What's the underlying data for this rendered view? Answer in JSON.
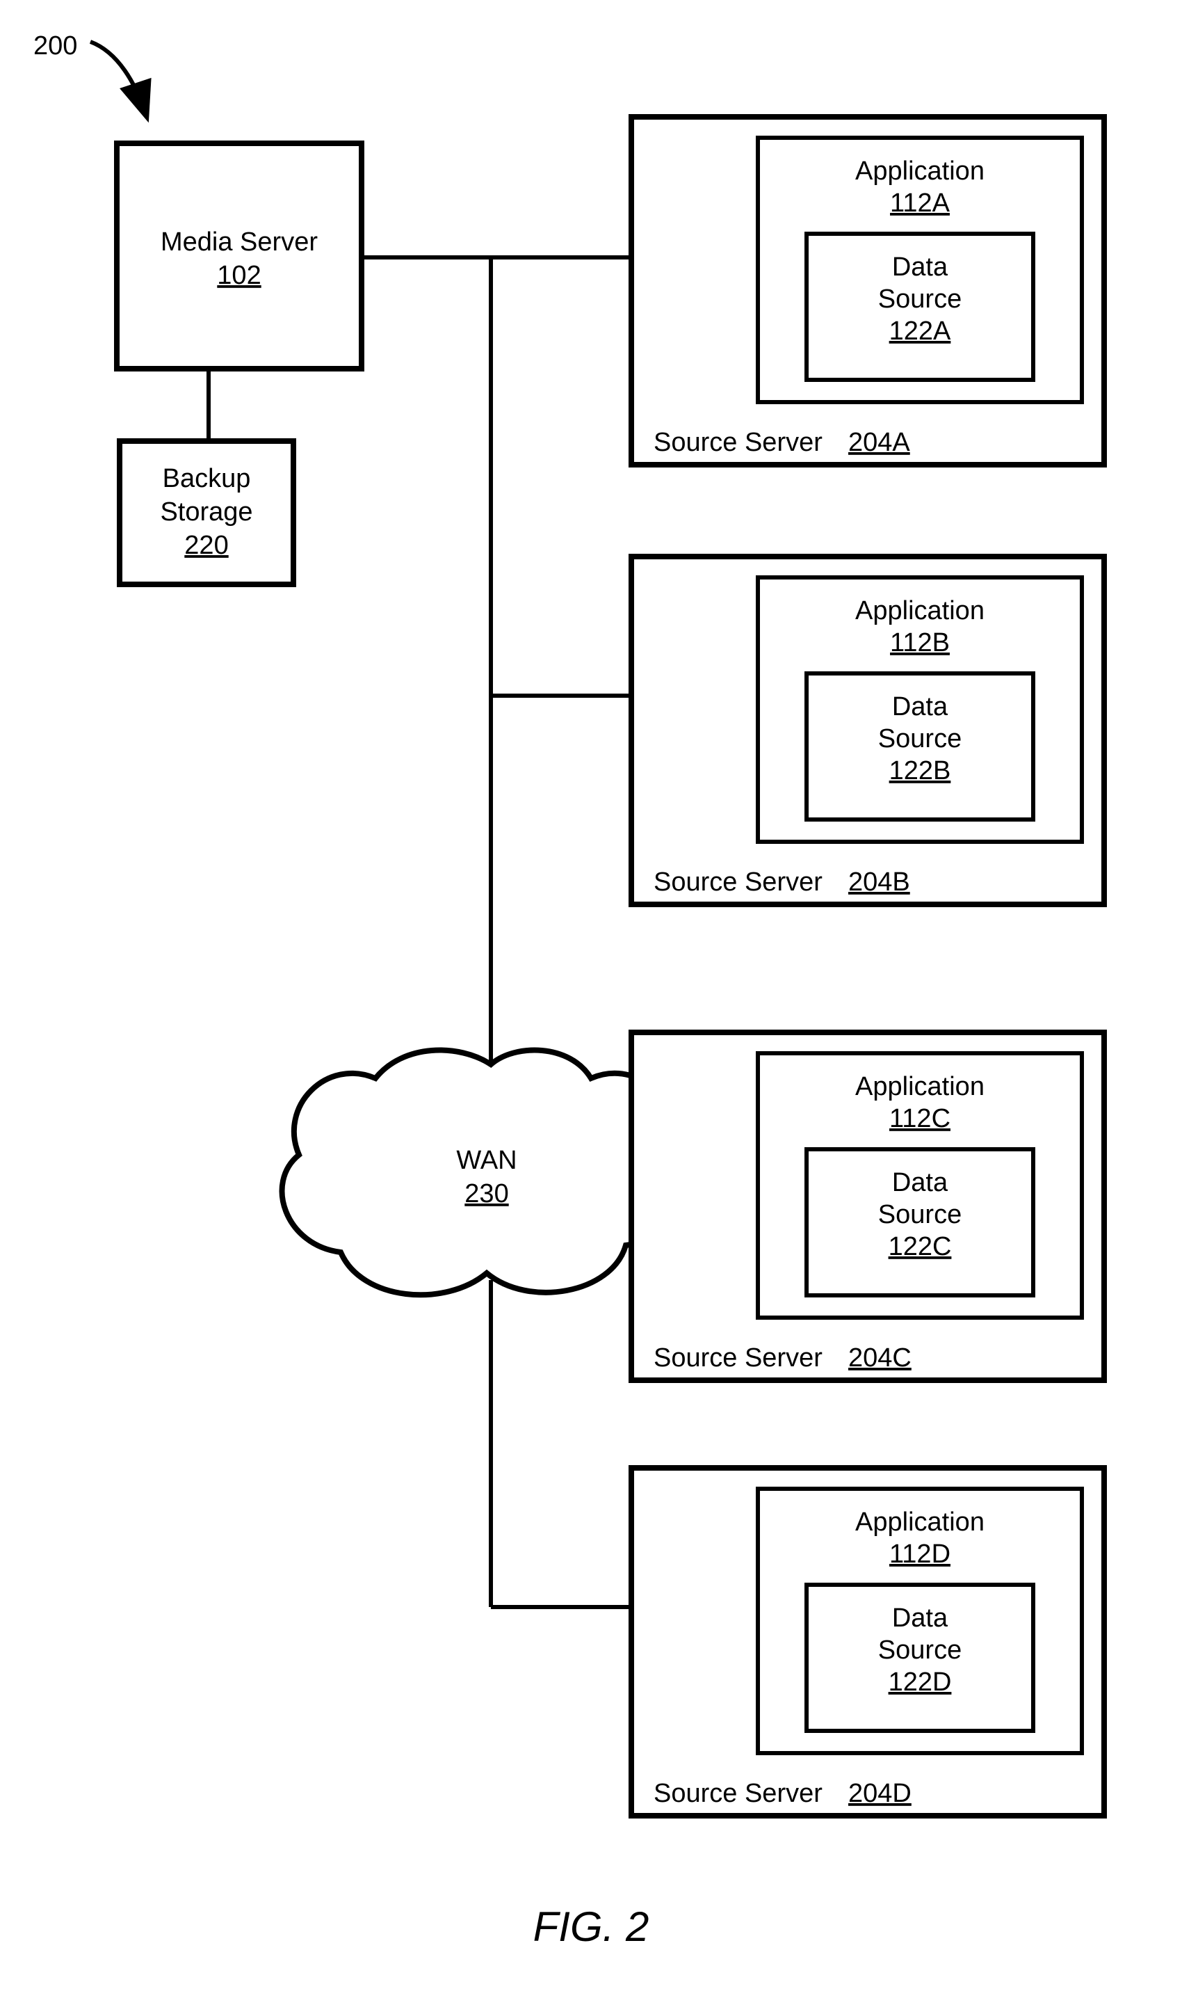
{
  "figureRef": "200",
  "caption": "FIG. 2",
  "mediaServer": {
    "label": "Media Server",
    "ref": "102"
  },
  "backupStorage": {
    "label1": "Backup",
    "label2": "Storage",
    "ref": "220"
  },
  "wan": {
    "label": "WAN",
    "ref": "230"
  },
  "servers": [
    {
      "serverLabel": "Source Server",
      "serverRef": "204A",
      "appLabel": "Application",
      "appRef": "112A",
      "dsLabel1": "Data",
      "dsLabel2": "Source",
      "dsRef": "122A"
    },
    {
      "serverLabel": "Source Server",
      "serverRef": "204B",
      "appLabel": "Application",
      "appRef": "112B",
      "dsLabel1": "Data",
      "dsLabel2": "Source",
      "dsRef": "122B"
    },
    {
      "serverLabel": "Source Server",
      "serverRef": "204C",
      "appLabel": "Application",
      "appRef": "112C",
      "dsLabel1": "Data",
      "dsLabel2": "Source",
      "dsRef": "122C"
    },
    {
      "serverLabel": "Source Server",
      "serverRef": "204D",
      "appLabel": "Application",
      "appRef": "112D",
      "dsLabel1": "Data",
      "dsLabel2": "Source",
      "dsRef": "122D"
    }
  ]
}
